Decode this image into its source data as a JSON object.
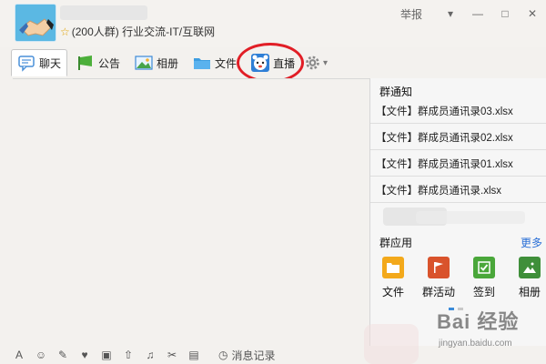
{
  "header": {
    "group_info": "(200人群) 行业交流-IT/互联网",
    "star": "☆",
    "report_label": "举报"
  },
  "window_buttons": {
    "dropdown": "▾",
    "minimize": "—",
    "maximize": "□",
    "close": "✕"
  },
  "toolbar": {
    "chat": "聊天",
    "announcement": "公告",
    "album": "相册",
    "file": "文件",
    "live": "直播"
  },
  "sidepanel": {
    "notice_title": "群通知",
    "files": [
      "【文件】群成员通讯录03.xlsx",
      "【文件】群成员通讯录02.xlsx",
      "【文件】群成员通讯录01.xlsx",
      "【文件】群成员通讯录.xlsx"
    ],
    "apps_title": "群应用",
    "apps_more": "更多",
    "apps": [
      {
        "label": "文件",
        "color": "#f3a91b"
      },
      {
        "label": "群活动",
        "color": "#d9532c"
      },
      {
        "label": "签到",
        "color": "#4aa73a"
      },
      {
        "label": "相册",
        "color": "#3f8f3a"
      }
    ]
  },
  "bottom": {
    "message_record": "消息记录"
  },
  "watermark": {
    "brand": "Bai 经验",
    "url": "jingyan.baidu.com"
  },
  "colors": {
    "highlight_circle": "#e11e26",
    "link": "#2a6fd6",
    "avatar_bg": "#5bb8e3"
  }
}
